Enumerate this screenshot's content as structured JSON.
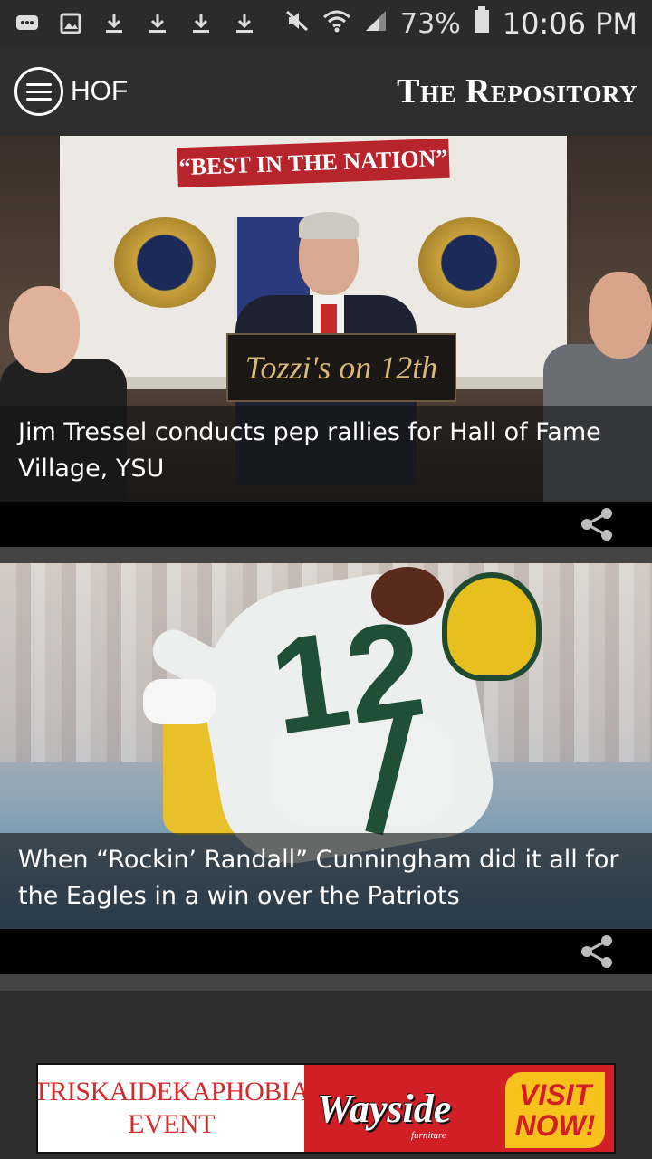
{
  "status_bar": {
    "notification_icons": [
      "messages-icon",
      "gallery-icon",
      "download-icon",
      "download-icon",
      "download-icon",
      "download-icon"
    ],
    "battery_percent": "73%",
    "time": "10:06 PM"
  },
  "app_bar": {
    "section_title": "HOF",
    "brand": "The Repository"
  },
  "stories": [
    {
      "headline": "Jim Tressel conducts pep rallies for Hall of Fame Village, YSU",
      "photo": {
        "banner_text": "“BEST IN THE NATION”",
        "podium_text": "Tozzi's on 12th"
      }
    },
    {
      "headline": "When “Rockin’ Randall” Cunningham did it all for the Eagles in a win over the Patriots",
      "photo": {
        "jersey_number": "12"
      }
    }
  ],
  "ad": {
    "left_line1": "TRISKAIDEKAPHOBIA",
    "left_line2": "EVENT",
    "brand": "Wayside",
    "brand_sub": "furniture",
    "cta_line1": "VISIT",
    "cta_line2": "NOW!"
  },
  "colors": {
    "app_bar": "#2e2e2e",
    "caption_overlay": "rgba(20,20,20,0.62)",
    "ad_red": "#d21f26",
    "ad_yellow": "#f6c21b"
  }
}
